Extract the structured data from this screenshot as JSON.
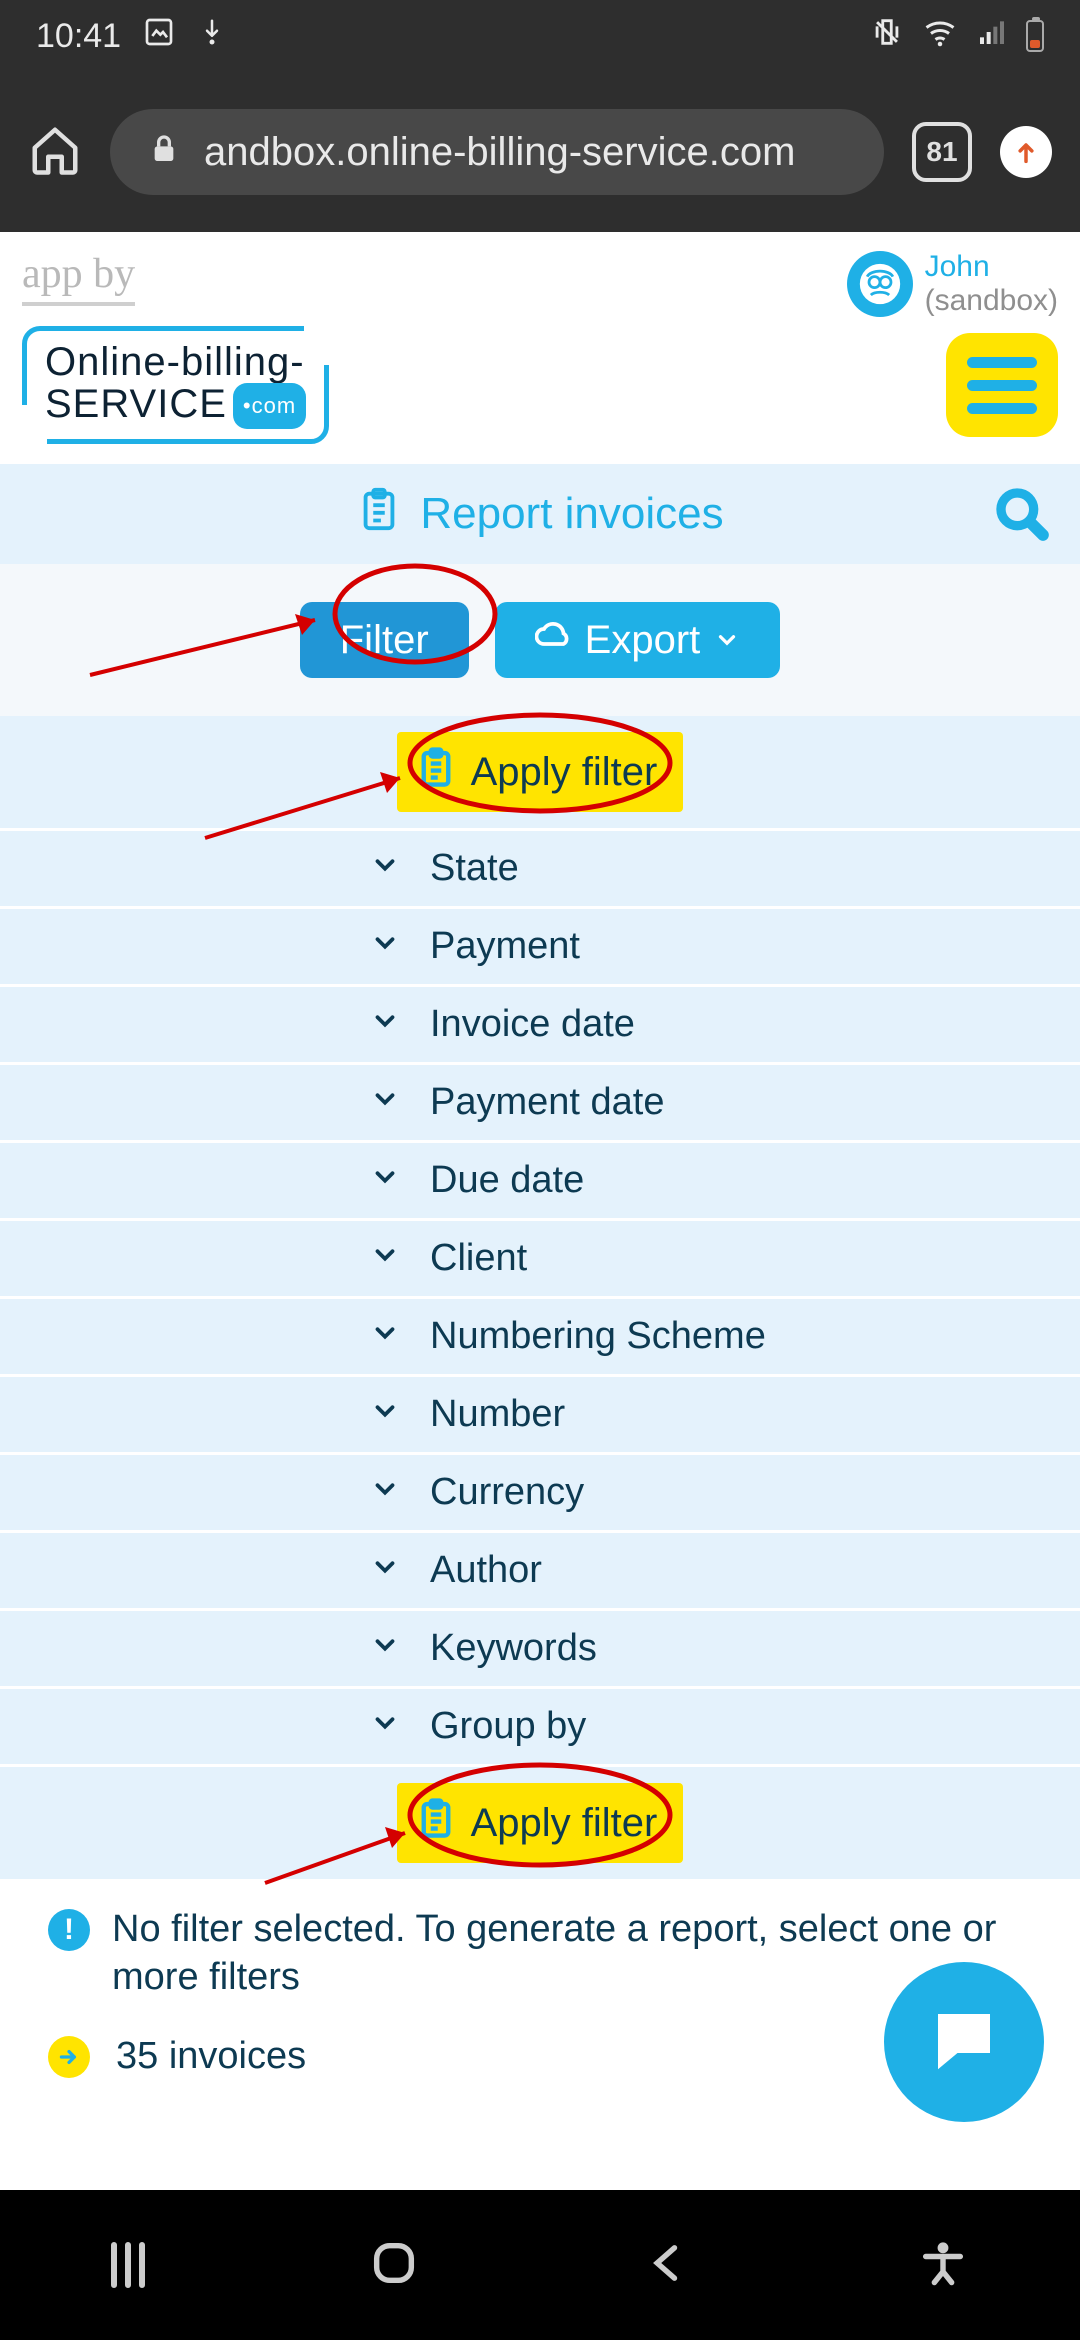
{
  "status_bar": {
    "time": "10:41"
  },
  "browser": {
    "url": "andbox.online-billing-service.com",
    "tab_count": "81"
  },
  "header": {
    "app_by": "app by",
    "logo_line1": "Online-billing-",
    "logo_line2": "SERVICE",
    "logo_com": "•com",
    "user_name": "John",
    "user_env": "(sandbox)"
  },
  "title_bar": {
    "label": "Report invoices"
  },
  "buttons": {
    "filter": "Filter",
    "export": "Export"
  },
  "apply_filter": {
    "label": "Apply filter"
  },
  "filters": [
    {
      "label": "State"
    },
    {
      "label": "Payment"
    },
    {
      "label": "Invoice date"
    },
    {
      "label": "Payment date"
    },
    {
      "label": "Due date"
    },
    {
      "label": "Client"
    },
    {
      "label": "Numbering Scheme"
    },
    {
      "label": "Number"
    },
    {
      "label": "Currency"
    },
    {
      "label": "Author"
    },
    {
      "label": "Keywords"
    },
    {
      "label": "Group by"
    }
  ],
  "info": {
    "message": "No filter selected. To generate a report, select one or more filters",
    "count": "35 invoices"
  }
}
